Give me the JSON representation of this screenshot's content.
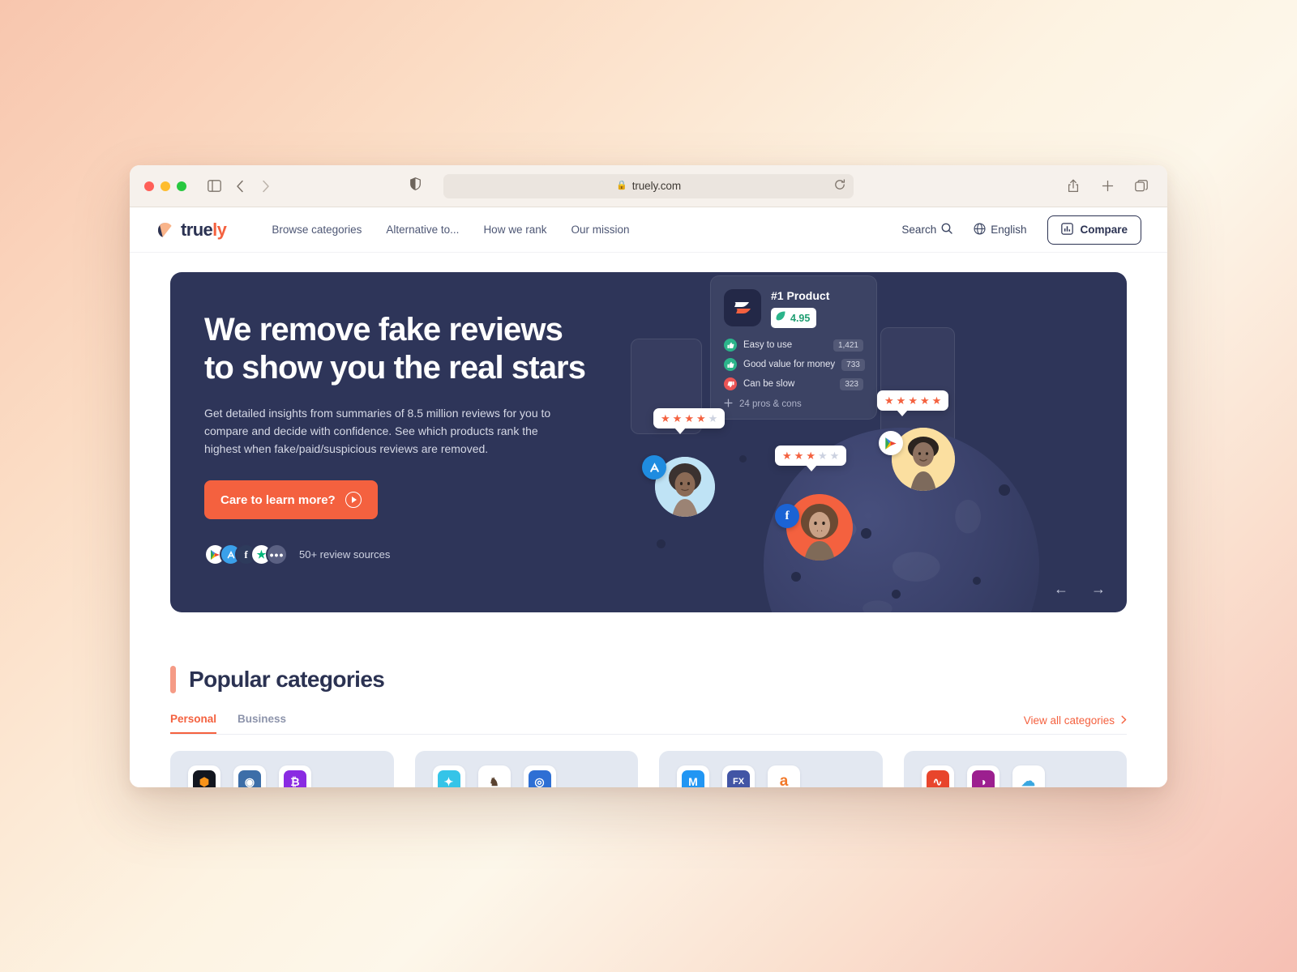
{
  "browser": {
    "url": "truely.com",
    "lock_icon": "lock-icon",
    "sidebar_icon": "sidebar-toggle-icon",
    "back_icon": "back-icon",
    "forward_icon": "forward-icon",
    "shield_icon": "privacy-shield-icon",
    "reload_icon": "reload-icon",
    "share_icon": "share-icon",
    "newtab_icon": "new-tab-icon",
    "tabs_icon": "tab-overview-icon"
  },
  "header": {
    "logo_text_dark": "true",
    "logo_text_accent": "ly",
    "nav": [
      {
        "label": "Browse categories"
      },
      {
        "label": "Alternative to..."
      },
      {
        "label": "How we rank"
      },
      {
        "label": "Our mission"
      }
    ],
    "search_label": "Search",
    "language_label": "English",
    "compare_label": "Compare"
  },
  "hero": {
    "title": "We remove fake reviews\nto show you the real stars",
    "subtitle": "Get detailed insights from summaries of 8.5 million reviews for you to compare and decide with confidence. See which products rank the highest when fake/paid/suspicious reviews are removed.",
    "cta_label": "Care to learn more?",
    "sources_label": "50+ review sources",
    "prev_arrow": "←",
    "next_arrow": "→",
    "product_card": {
      "name": "#1 Product",
      "score": "4.95",
      "rows": [
        {
          "label": "Easy to use",
          "count": "1,421",
          "sentiment": "positive"
        },
        {
          "label": "Good value for money",
          "count": "733",
          "sentiment": "positive"
        },
        {
          "label": "Can be slow",
          "count": "323",
          "sentiment": "negative"
        }
      ],
      "more_label": "24 pros & cons"
    },
    "rating_bubbles": [
      {
        "name": "bubble-four-star",
        "filled": 4,
        "total": 5
      },
      {
        "name": "bubble-three-star",
        "filled": 3,
        "total": 5
      },
      {
        "name": "bubble-five-star",
        "filled": 5,
        "total": 5
      }
    ],
    "source_badges": [
      "google-play-icon",
      "app-store-icon",
      "facebook-icon",
      "trustpilot-star-icon",
      "more-sources-icon"
    ]
  },
  "categories": {
    "heading": "Popular categories",
    "tabs": [
      {
        "label": "Personal",
        "active": true
      },
      {
        "label": "Business",
        "active": false
      }
    ],
    "view_all_label": "View all categories",
    "cards": [
      {
        "name": "crypto-category",
        "icons": [
          {
            "glyph": "⬢",
            "bg": "#12161f",
            "fg": "#f7931a"
          },
          {
            "glyph": "◉",
            "bg": "#3d6ea8",
            "fg": "#ffffff"
          },
          {
            "glyph": "₿",
            "bg": "#8a2be2",
            "fg": "#ffffff"
          }
        ]
      },
      {
        "name": "fitness-category",
        "icons": [
          {
            "glyph": "✦",
            "bg": "#35c4e8",
            "fg": "#ffffff"
          },
          {
            "glyph": "♞",
            "bg": "#ffffff",
            "fg": "#5a4230"
          },
          {
            "glyph": "◎",
            "bg": "#2e6fd4",
            "fg": "#ffffff"
          }
        ]
      },
      {
        "name": "email-finance-category",
        "icons": [
          {
            "glyph": "M",
            "bg": "#2196f3",
            "fg": "#ffffff"
          },
          {
            "glyph": "FX",
            "bg": "#4255a5",
            "fg": "#ffffff"
          },
          {
            "glyph": "a",
            "bg": "#ffffff",
            "fg": "#f2792a"
          }
        ]
      },
      {
        "name": "analytics-media-category",
        "icons": [
          {
            "glyph": "∿",
            "bg": "#e8452c",
            "fg": "#ffffff"
          },
          {
            "glyph": "◑",
            "bg": "#9c1f8f",
            "fg": "#ffffff"
          },
          {
            "glyph": "☁",
            "bg": "#ffffff",
            "fg": "#3aa7e0"
          }
        ]
      }
    ]
  },
  "colors": {
    "accent": "#f4613f",
    "navy": "#2b3252",
    "hero_bg": "#2e3559",
    "card_bg": "#e3e8f1",
    "positive": "#2bb48a",
    "negative": "#ea5455"
  }
}
